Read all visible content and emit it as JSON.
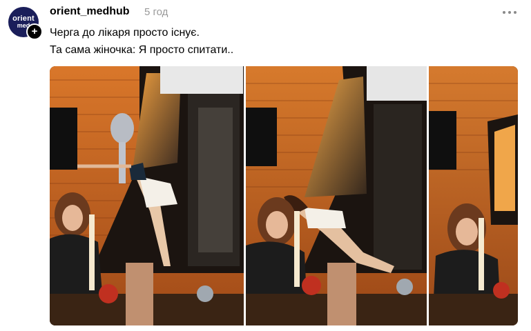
{
  "post": {
    "avatar": {
      "line1": "orient",
      "line2": "med"
    },
    "follow_icon": "plus-icon",
    "username": "orient_medhub",
    "timestamp": "5 год",
    "more_icon": "more-horizontal-icon",
    "caption_lines": [
      "Черга до лікаря просто існує.",
      "Та сама жіночка: Я просто спитати.."
    ],
    "media": {
      "frames": 3,
      "description_icons": [
        "photo-frame-1",
        "photo-frame-2",
        "photo-frame-3"
      ]
    }
  }
}
